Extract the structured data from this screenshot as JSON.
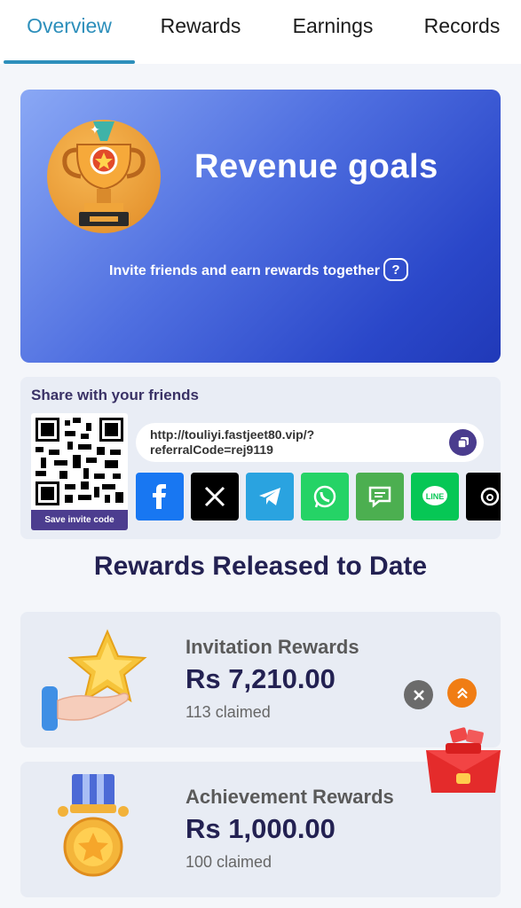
{
  "tabs": [
    {
      "label": "Overview",
      "active": true
    },
    {
      "label": "Rewards",
      "active": false
    },
    {
      "label": "Earnings",
      "active": false
    },
    {
      "label": "Records",
      "active": false
    }
  ],
  "banner": {
    "title": "Revenue goals",
    "subtitle": "Invite friends and earn rewards together",
    "help_icon": "question-icon"
  },
  "share": {
    "title": "Share with your friends",
    "link_line1": "http://touliyi.fastjeet80.vip/?",
    "link_line2": "referralCode=rej9119",
    "save_button": "Save invite code",
    "socials": [
      {
        "name": "facebook",
        "color": "#1877f2"
      },
      {
        "name": "x",
        "color": "#000000"
      },
      {
        "name": "telegram",
        "color": "#2aa3e0"
      },
      {
        "name": "whatsapp",
        "color": "#25d366"
      },
      {
        "name": "sms",
        "color": "#4caf50"
      },
      {
        "name": "line",
        "color": "#06c755"
      },
      {
        "name": "threads",
        "color": "#000000"
      }
    ]
  },
  "rewards_heading": "Rewards Released to Date",
  "rewards": [
    {
      "label": "Invitation Rewards",
      "amount": "Rs  7,210.00",
      "claimed": "113 claimed",
      "icon": "star-hand-icon"
    },
    {
      "label": "Achievement Rewards",
      "amount": "Rs  1,000.00",
      "claimed": "100 claimed",
      "icon": "medal-icon"
    }
  ],
  "colors": {
    "accent": "#2d8fbb",
    "primary_dark": "#232152",
    "button_purple": "#4c3d8f",
    "up_orange": "#f07d14"
  }
}
